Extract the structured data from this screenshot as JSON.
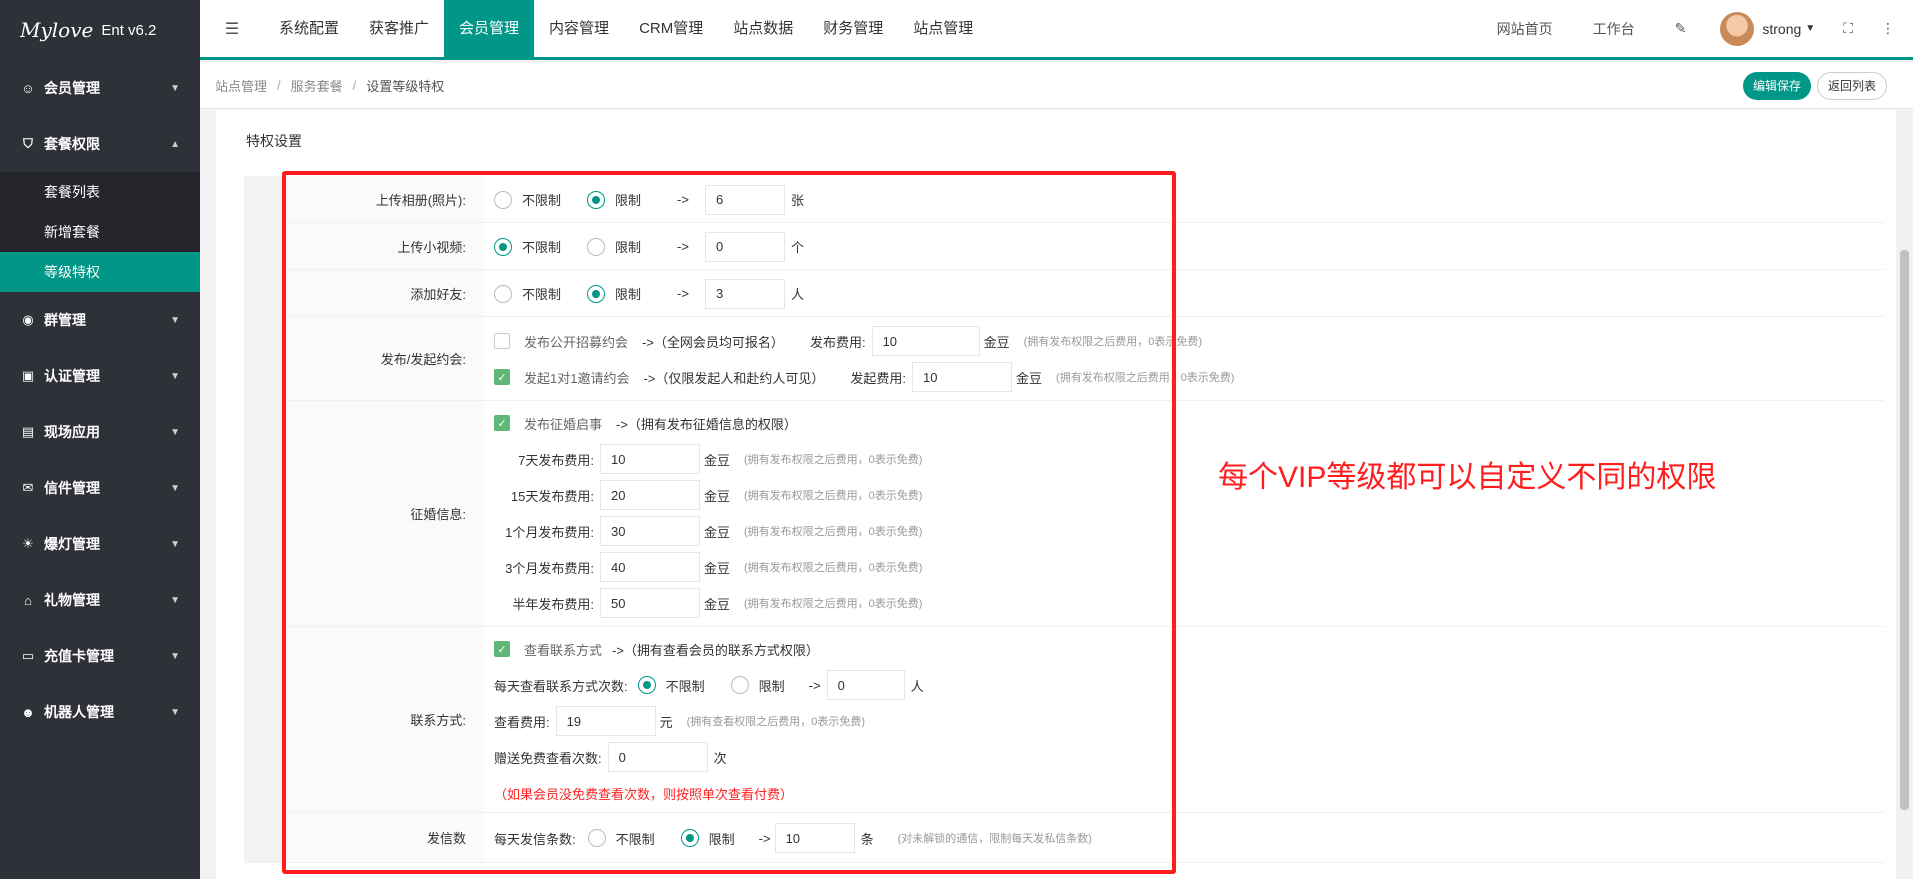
{
  "app": {
    "logo_script": "Mylove",
    "logo_version": "Ent v6.2"
  },
  "sidebar": {
    "items": [
      {
        "label": "会员管理",
        "icon": "user-icon"
      },
      {
        "label": "套餐权限",
        "icon": "shield-icon",
        "expanded": true,
        "children": [
          {
            "label": "套餐列表"
          },
          {
            "label": "新增套餐"
          },
          {
            "label": "等级特权",
            "active": true
          }
        ]
      },
      {
        "label": "群管理",
        "icon": "group-icon"
      },
      {
        "label": "认证管理",
        "icon": "id-card-icon"
      },
      {
        "label": "现场应用",
        "icon": "picture-icon"
      },
      {
        "label": "信件管理",
        "icon": "mail-icon"
      },
      {
        "label": "爆灯管理",
        "icon": "bulb-icon"
      },
      {
        "label": "礼物管理",
        "icon": "gift-icon"
      },
      {
        "label": "充值卡管理",
        "icon": "card-icon"
      },
      {
        "label": "机器人管理",
        "icon": "robot-icon"
      }
    ]
  },
  "topnav": {
    "items": [
      "系统配置",
      "获客推广",
      "会员管理",
      "内容管理",
      "CRM管理",
      "站点数据",
      "财务管理",
      "站点管理"
    ],
    "active_index": 2,
    "right": {
      "home": "网站首页",
      "workbench": "工作台",
      "username": "strong"
    }
  },
  "breadcrumb": [
    "站点管理",
    "服务套餐",
    "设置等级特权"
  ],
  "actions": {
    "save": "编辑保存",
    "back": "返回列表"
  },
  "section_title": "特权设置",
  "opts": {
    "unlimited": "不限制",
    "limited": "限制",
    "arrow": "->"
  },
  "form": {
    "album": {
      "label": "上传相册(照片):",
      "value": "6",
      "unit": "张"
    },
    "video": {
      "label": "上传小视频:",
      "value": "0",
      "unit": "个"
    },
    "friend": {
      "label": "添加好友:",
      "value": "3",
      "unit": "人"
    },
    "dating": {
      "label": "发布/发起约会:",
      "public_text": "发布公开招募约会",
      "public_desc": "->（全网会员均可报名）",
      "public_fee_label": "发布费用:",
      "public_fee": "10",
      "invite_text": "发起1对1邀请约会",
      "invite_desc": "->（仅限发起人和赴约人可见）",
      "invite_fee_label": "发起费用:",
      "invite_fee": "10",
      "unit": "金豆",
      "hint": "(拥有发布权限之后费用，0表示免费)"
    },
    "marriage": {
      "label": "征婚信息:",
      "check_text": "发布征婚启事",
      "check_desc": "->（拥有发布征婚信息的权限）",
      "fees": [
        {
          "label": "7天发布费用:",
          "value": "10"
        },
        {
          "label": "15天发布费用:",
          "value": "20"
        },
        {
          "label": "1个月发布费用:",
          "value": "30"
        },
        {
          "label": "3个月发布费用:",
          "value": "40"
        },
        {
          "label": "半年发布费用:",
          "value": "50"
        }
      ],
      "unit": "金豆",
      "hint": "(拥有发布权限之后费用，0表示免费)"
    },
    "contact": {
      "label": "联系方式:",
      "check_text": "查看联系方式",
      "check_desc": "->（拥有查看会员的联系方式权限）",
      "daily_label": "每天查看联系方式次数:",
      "daily_value": "0",
      "daily_unit": "人",
      "fee_label": "查看费用:",
      "fee_value": "19",
      "fee_unit": "元",
      "fee_hint": "(拥有查看权限之后费用，0表示免费)",
      "free_label": "赠送免费查看次数:",
      "free_value": "0",
      "free_unit": "次",
      "note": "（如果会员没免费查看次数，则按照单次查看付费）"
    },
    "letters": {
      "label": "发信数",
      "daily_label": "每天发信条数:",
      "value": "10",
      "unit": "条",
      "hint": "(对未解锁的通信，限制每天发私信条数)"
    }
  },
  "annotation": "每个VIP等级都可以自定义不同的权限"
}
